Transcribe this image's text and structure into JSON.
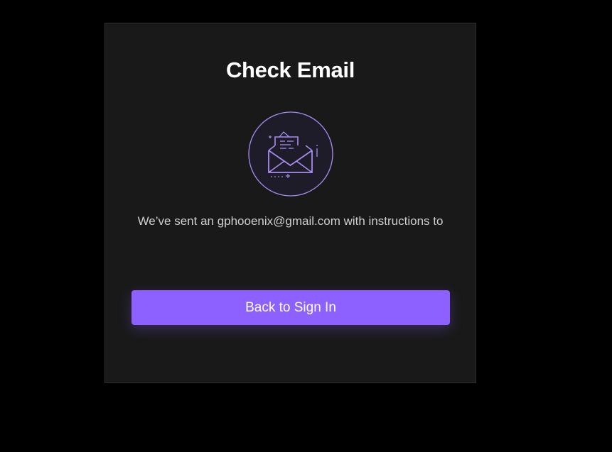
{
  "card": {
    "title": "Check Email",
    "icon": "open-envelope-icon",
    "message": "We’ve sent an gphooenix@gmail.com with instructions to",
    "button_label": "Back to Sign In"
  },
  "colors": {
    "background": "#000000",
    "card": "#191919",
    "accent": "#8c61ff",
    "icon_stroke": "#a98cf0"
  }
}
